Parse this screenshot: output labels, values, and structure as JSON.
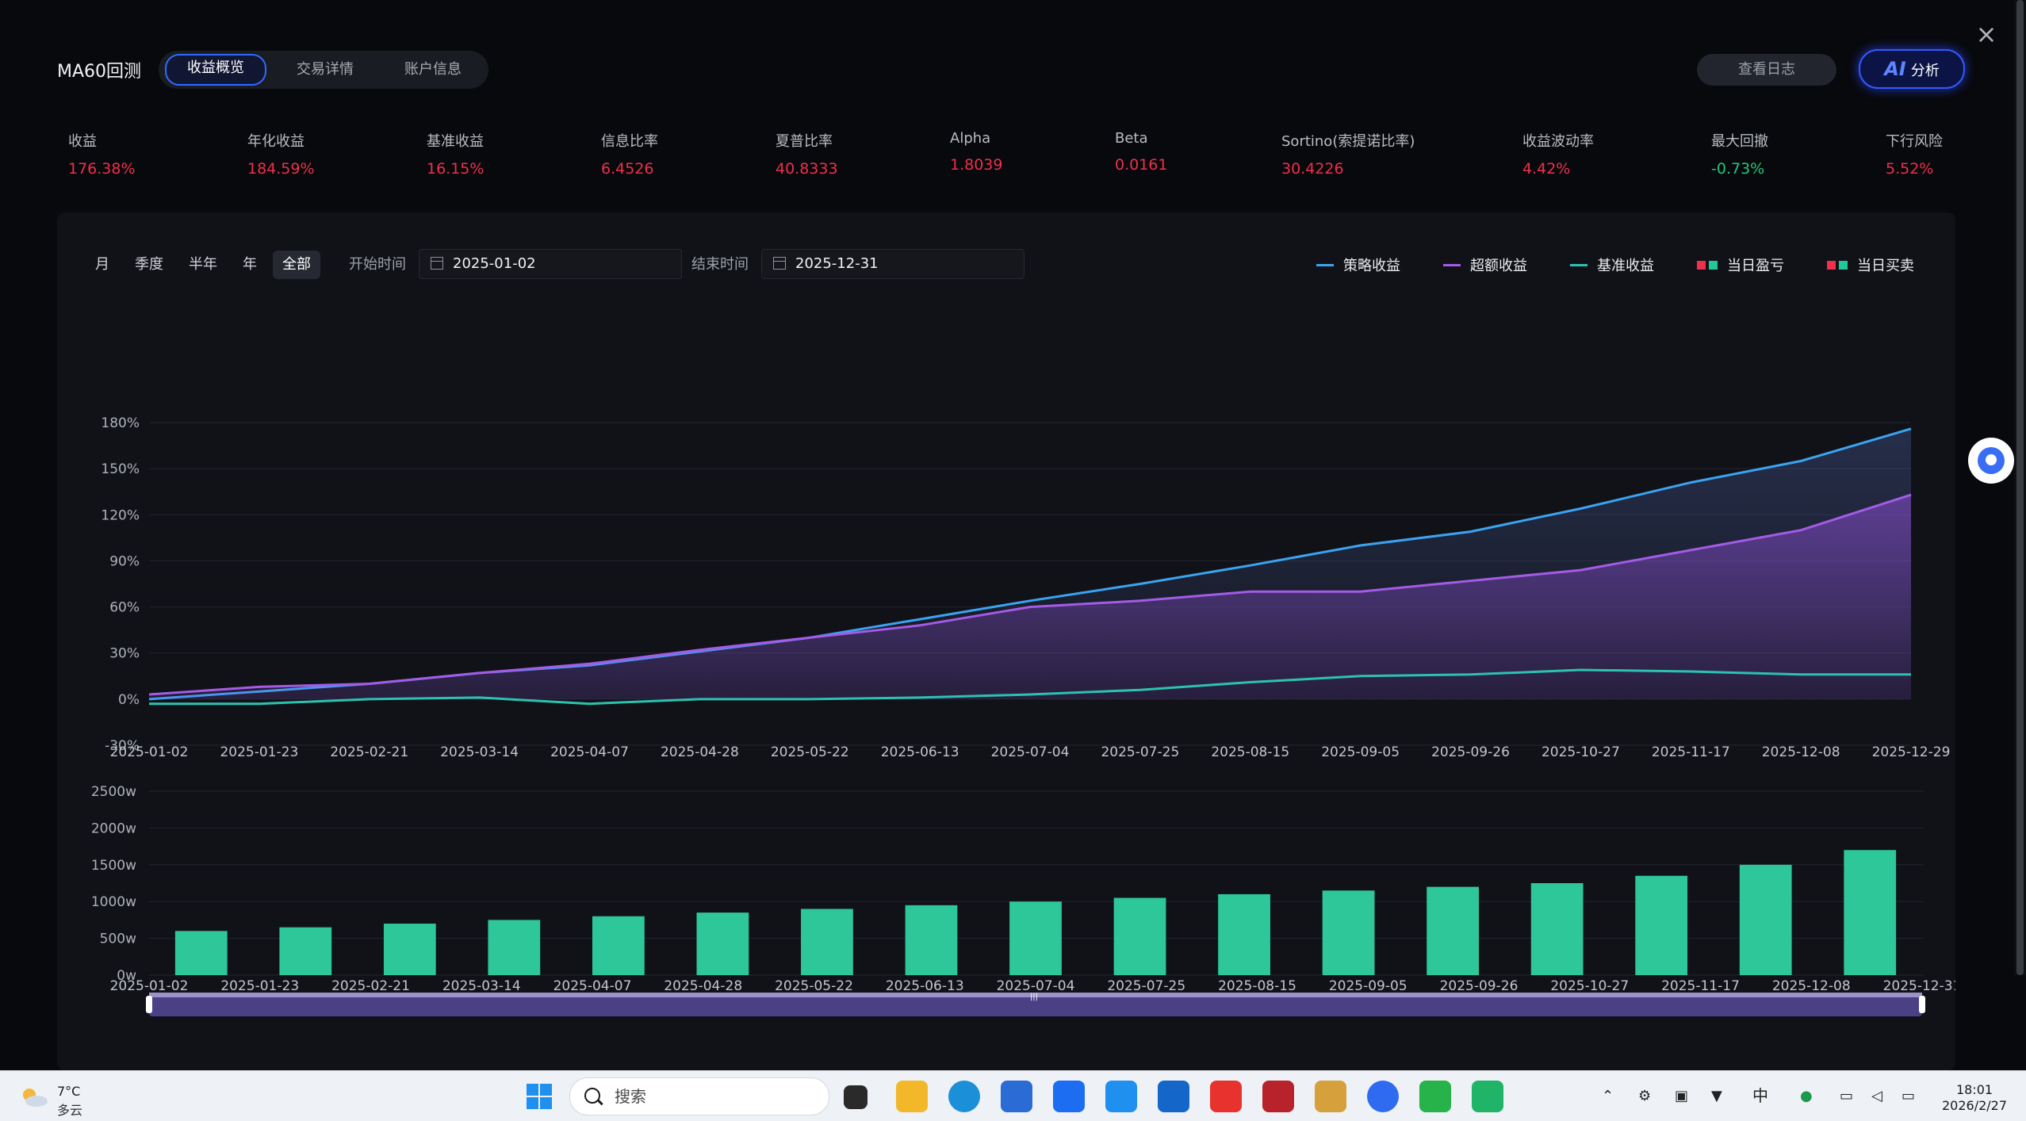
{
  "app": {
    "title": "MA60回测",
    "tabs": [
      {
        "label": "收益概览",
        "active": true
      },
      {
        "label": "交易详情",
        "active": false
      },
      {
        "label": "账户信息",
        "active": false
      }
    ],
    "log_button": "查看日志",
    "ai_button": {
      "badge": "AI",
      "label": "分析"
    }
  },
  "metrics": [
    {
      "label": "收益",
      "value": "176.38%",
      "color": "#ef2f4c"
    },
    {
      "label": "年化收益",
      "value": "184.59%",
      "color": "#ef2f4c"
    },
    {
      "label": "基准收益",
      "value": "16.15%",
      "color": "#ef2f4c"
    },
    {
      "label": "信息比率",
      "value": "6.4526",
      "color": "#ef2f4c"
    },
    {
      "label": "夏普比率",
      "value": "40.8333",
      "color": "#ef2f4c"
    },
    {
      "label": "Alpha",
      "value": "1.8039",
      "color": "#ef2f4c"
    },
    {
      "label": "Beta",
      "value": "0.0161",
      "color": "#ef2f4c"
    },
    {
      "label": "Sortino(索提诺比率)",
      "value": "30.4226",
      "color": "#ef2f4c"
    },
    {
      "label": "收益波动率",
      "value": "4.42%",
      "color": "#ef2f4c"
    },
    {
      "label": "最大回撤",
      "value": "-0.73%",
      "color": "#22c77a"
    },
    {
      "label": "下行风险",
      "value": "5.52%",
      "color": "#ef2f4c"
    }
  ],
  "filters": {
    "periods": [
      {
        "label": "月",
        "active": false
      },
      {
        "label": "季度",
        "active": false
      },
      {
        "label": "半年",
        "active": false
      },
      {
        "label": "年",
        "active": false
      },
      {
        "label": "全部",
        "active": true
      }
    ],
    "start_label": "开始时间",
    "start_date": "2025-01-02",
    "end_label": "结束时间",
    "end_date": "2025-12-31"
  },
  "legend": [
    {
      "label": "策略收益",
      "kind": "line",
      "color": "#3aa4f2"
    },
    {
      "label": "超额收益",
      "kind": "line",
      "color": "#a45be6"
    },
    {
      "label": "基准收益",
      "kind": "line",
      "color": "#2cc2b0"
    },
    {
      "label": "当日盈亏",
      "kind": "squares",
      "colors": [
        "#ef2f4c",
        "#22c79a"
      ]
    },
    {
      "label": "当日买卖",
      "kind": "squares",
      "colors": [
        "#ef2f4c",
        "#22c79a"
      ]
    }
  ],
  "chart_data": [
    {
      "type": "line",
      "title": "",
      "ylim": [
        -30,
        180
      ],
      "y_ticks": [
        180,
        150,
        120,
        90,
        60,
        30,
        0,
        -30
      ],
      "y_tick_labels": [
        "180%",
        "150%",
        "120%",
        "90%",
        "60%",
        "30%",
        "0%",
        "-30%"
      ],
      "x_ticks": [
        "2025-01-02",
        "2025-01-23",
        "2025-02-21",
        "2025-03-14",
        "2025-04-07",
        "2025-04-28",
        "2025-05-22",
        "2025-06-13",
        "2025-07-04",
        "2025-07-25",
        "2025-08-15",
        "2025-09-05",
        "2025-09-26",
        "2025-10-27",
        "2025-11-17",
        "2025-12-08",
        "2025-12-29"
      ],
      "grid": true,
      "series": [
        {
          "name": "策略收益",
          "color": "#3aa4f2",
          "values": [
            0,
            5,
            10,
            17,
            22,
            31,
            40,
            52,
            64,
            75,
            87,
            100,
            109,
            124,
            141,
            155,
            176
          ]
        },
        {
          "name": "超额收益",
          "color": "#a45be6",
          "values": [
            3,
            8,
            10,
            17,
            23,
            32,
            40,
            48,
            60,
            64,
            70,
            70,
            77,
            84,
            97,
            110,
            133
          ]
        },
        {
          "name": "基准收益",
          "color": "#2cc2b0",
          "values": [
            -3,
            -3,
            0,
            1,
            -3,
            0,
            0,
            1,
            3,
            6,
            11,
            15,
            16,
            19,
            18,
            16,
            16
          ]
        }
      ]
    },
    {
      "type": "bar",
      "title": "",
      "ylim": [
        0,
        2500
      ],
      "y_ticks": [
        2500,
        2000,
        1500,
        1000,
        500,
        0
      ],
      "y_tick_labels": [
        "2500w",
        "2000w",
        "1500w",
        "1000w",
        "500w",
        "0w"
      ],
      "x_ticks": [
        "2025-01-02",
        "2025-01-23",
        "2025-02-21",
        "2025-03-14",
        "2025-04-07",
        "2025-04-28",
        "2025-05-22",
        "2025-06-13",
        "2025-07-04",
        "2025-07-25",
        "2025-08-15",
        "2025-09-05",
        "2025-09-26",
        "2025-10-27",
        "2025-11-17",
        "2025-12-08",
        "2025-12-31"
      ],
      "grid": true,
      "series": [
        {
          "color": "#2dc79a",
          "values": [
            600,
            650,
            700,
            750,
            800,
            850,
            900,
            950,
            1000,
            1050,
            1100,
            1150,
            1200,
            1250,
            1350,
            1500,
            1700
          ]
        }
      ]
    }
  ],
  "side_widget_icon": "chat-bubble-icon",
  "taskbar": {
    "weather_temp": "7°C",
    "weather_desc": "多云",
    "search_placeholder": "搜索",
    "ime": "中",
    "time": "18:01",
    "date": "2026/2/27"
  }
}
